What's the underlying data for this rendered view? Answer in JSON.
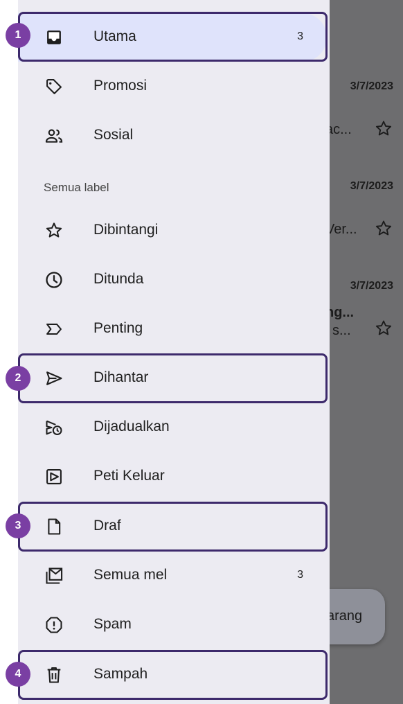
{
  "background": {
    "rows": [
      {
        "date": "3/7/2023",
        "snippet": "ac...",
        "subject": ""
      },
      {
        "date": "3/7/2023",
        "snippet": "Ver...",
        "subject": ""
      },
      {
        "date": "3/7/2023",
        "snippet": "l s...",
        "subject": "ng..."
      }
    ],
    "compose_label": "arang"
  },
  "drawer": {
    "items": [
      {
        "label": "Utama",
        "count": "3",
        "icon": "inbox-icon"
      },
      {
        "label": "Promosi",
        "count": "",
        "icon": "tag-icon"
      },
      {
        "label": "Sosial",
        "count": "",
        "icon": "people-icon"
      },
      {
        "label": "Dibintangi",
        "count": "",
        "icon": "star-icon"
      },
      {
        "label": "Ditunda",
        "count": "",
        "icon": "clock-icon"
      },
      {
        "label": "Penting",
        "count": "",
        "icon": "important-icon"
      },
      {
        "label": "Dihantar",
        "count": "",
        "icon": "send-icon"
      },
      {
        "label": "Dijadualkan",
        "count": "",
        "icon": "scheduled-send-icon"
      },
      {
        "label": "Peti Keluar",
        "count": "",
        "icon": "outbox-icon"
      },
      {
        "label": "Draf",
        "count": "",
        "icon": "draft-icon"
      },
      {
        "label": "Semua mel",
        "count": "3",
        "icon": "all-mail-icon"
      },
      {
        "label": "Spam",
        "count": "",
        "icon": "spam-icon"
      },
      {
        "label": "Sampah",
        "count": "",
        "icon": "trash-icon"
      }
    ],
    "section_label": "Semua label"
  },
  "annotations": [
    {
      "number": "1"
    },
    {
      "number": "2"
    },
    {
      "number": "3"
    },
    {
      "number": "4"
    }
  ],
  "colors": {
    "accent": "#7a3fa3",
    "highlight_border": "#3d2a6c",
    "active_bg": "#dfe3fb"
  }
}
